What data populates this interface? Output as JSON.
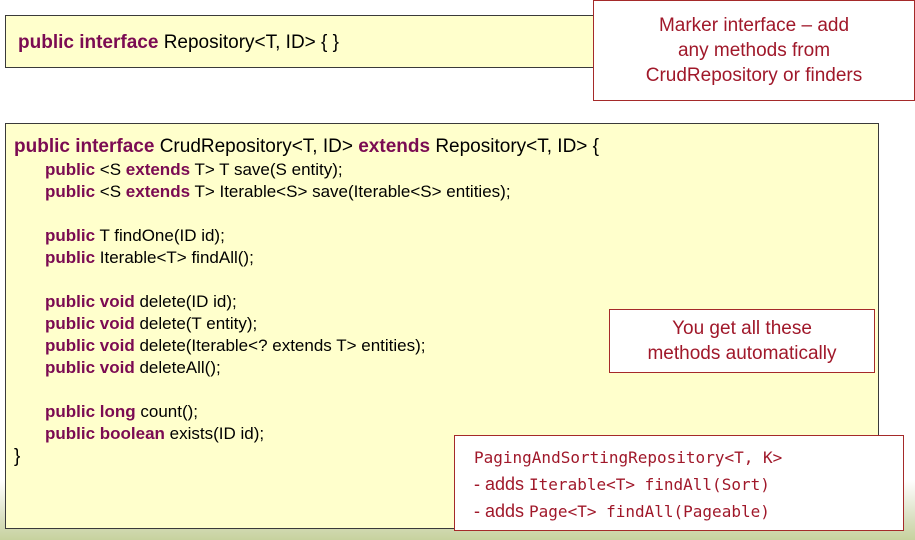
{
  "marker_box": {
    "keyword": "public interface",
    "declaration": " Repository<T, ID> {  }"
  },
  "crud_box": {
    "header": {
      "keyword": "public interface",
      "name": " CrudRepository<T, ID> ",
      "extends_kw": "extends",
      "rest": " Repository<T, ID> {"
    },
    "methods": [
      {
        "p1": "public",
        "t1": " <S ",
        "p2": "extends",
        "t2": " T> T save(S entity);"
      },
      {
        "p1": "public",
        "t1": " <S ",
        "p2": "extends",
        "t2": " T> Iterable<S> save(Iterable<S> entities);"
      },
      {
        "kw": "public",
        "text": " T findOne(ID id);"
      },
      {
        "kw": "public",
        "text": " Iterable<T> findAll();"
      },
      {
        "kw": "public void",
        "text": " delete(ID id);"
      },
      {
        "kw": "public void",
        "text": " delete(T entity);"
      },
      {
        "kw": "public void",
        "text": " delete(Iterable<? extends T> entities);"
      },
      {
        "kw": "public void",
        "text": " deleteAll();"
      },
      {
        "kw": "public long",
        "text": " count();"
      },
      {
        "kw": "public boolean",
        "text": " exists(ID id);"
      }
    ],
    "closing": "}"
  },
  "notes": {
    "marker": [
      "Marker interface – add",
      "any methods from",
      "CrudRepository or finders"
    ],
    "automatic": [
      "You get all these",
      "methods automatically"
    ],
    "paging": {
      "title": "PagingAndSortingRepository<T, K>",
      "adds_prefix": "- adds ",
      "line1": "Iterable<T> findAll(Sort)",
      "line2": "Page<T> findAll(Pageable)"
    }
  },
  "colors": {
    "keyword": "#7b0b52",
    "note_text": "#a0182a",
    "code_bg": "#ffffcc"
  }
}
